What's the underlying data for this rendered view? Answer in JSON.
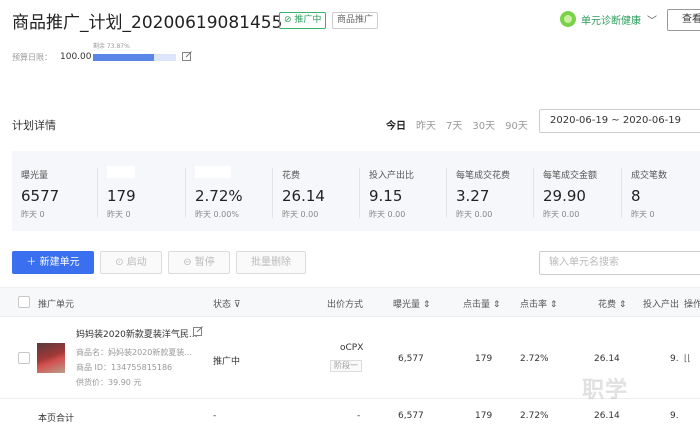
{
  "header": {
    "title": "商品推广_计划_20200619081455",
    "status_badge": "⊘ 推广中",
    "type_badge": "商品推广",
    "health_label": "单元诊断健康",
    "view_button": "查看"
  },
  "budget": {
    "remain_text": "剩余 73.87%",
    "label": "预算日限：",
    "value": "100.00",
    "fill_fraction": 0.74
  },
  "plan_detail": {
    "title": "计划详情",
    "ranges": [
      "今日",
      "昨天",
      "7天",
      "30天",
      "90天"
    ],
    "active_range": "今日",
    "date_range": "2020-06-19 ~ 2020-06-19"
  },
  "metrics": [
    {
      "label": "曝光量",
      "value": "6577",
      "yesterday": "昨天 0"
    },
    {
      "label": "",
      "value": "179",
      "yesterday": "昨天 0"
    },
    {
      "label": "",
      "value": "2.72%",
      "yesterday": "昨天 0.00%"
    },
    {
      "label": "花费",
      "value": "26.14",
      "yesterday": "昨天 0.00"
    },
    {
      "label": "投入产出比",
      "value": "9.15",
      "yesterday": "昨天 0.00"
    },
    {
      "label": "每笔成交花费",
      "value": "3.27",
      "yesterday": "昨天 0.00"
    },
    {
      "label": "每笔成交金额",
      "value": "29.90",
      "yesterday": "昨天 0.00"
    },
    {
      "label": "成交笔数",
      "value": "8",
      "yesterday": "昨天 0"
    }
  ],
  "toolbar": {
    "new_unit": "＋ 新建单元",
    "start": "⊙ 启动",
    "pause": "⊖ 暂停",
    "bulk_delete": "批量删除",
    "search_placeholder": "输入单元名搜索"
  },
  "table": {
    "headers": {
      "unit": "推广单元",
      "status": "状态 ⊽",
      "bid": "出价方式",
      "impressions": "曝光量 ⇕",
      "clicks": "点击量 ⇕",
      "ctr": "点击率 ⇕",
      "cost": "花费 ⇕",
      "roi": "投入产出",
      "ops": "操作"
    },
    "row": {
      "name": "妈妈装2020新款夏装洋气民...",
      "product_name": "商品名：妈妈装2020新款夏装...",
      "product_id": "商品 ID：134755815186",
      "price": "供货价：39.90 元",
      "status": "推广中",
      "bid": "oCPX",
      "stage": "阶段一",
      "impressions": "6,577",
      "clicks": "179",
      "ctr": "2.72%",
      "cost": "26.14",
      "roi": "9."
    },
    "total": {
      "label": "本页合计",
      "status": "-",
      "bid": "-",
      "impressions": "6,577",
      "clicks": "179",
      "ctr": "2.72%",
      "cost": "26.14",
      "roi": "9."
    }
  },
  "watermark": "职学"
}
